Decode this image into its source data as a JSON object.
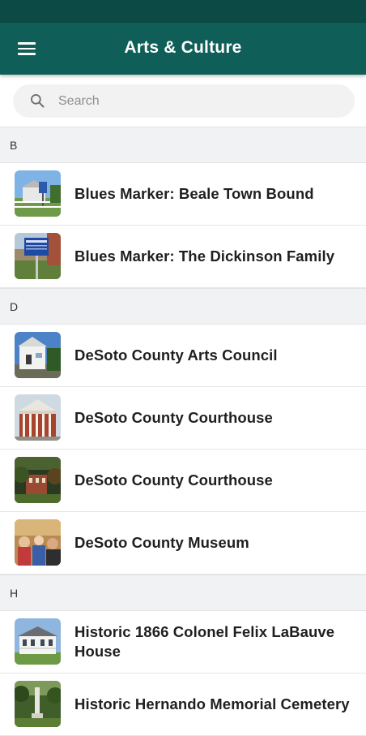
{
  "status_bar": {
    "glyph": "′′"
  },
  "app_bar": {
    "title": "Arts & Culture",
    "menu_icon": "hamburger-menu-icon"
  },
  "search": {
    "placeholder": "Search",
    "value": "",
    "icon": "search-icon"
  },
  "sections": [
    {
      "letter": "B",
      "items": [
        {
          "label": "Blues Marker: Beale Town Bound",
          "thumb": "marker-building"
        },
        {
          "label": "Blues Marker: The Dickinson Family",
          "thumb": "blue-sign"
        }
      ]
    },
    {
      "letter": "D",
      "items": [
        {
          "label": "DeSoto County Arts Council",
          "thumb": "white-building"
        },
        {
          "label": "DeSoto County Courthouse",
          "thumb": "courthouse-columns"
        },
        {
          "label": "DeSoto County Courthouse",
          "thumb": "courthouse-trees"
        },
        {
          "label": "DeSoto County Museum",
          "thumb": "museum-crowd"
        }
      ]
    },
    {
      "letter": "H",
      "items": [
        {
          "label": "Historic 1866 Colonel Felix LaBauve House",
          "thumb": "white-house"
        },
        {
          "label": "Historic Hernando Memorial Cemetery",
          "thumb": "cemetery-monument"
        }
      ]
    }
  ],
  "colors": {
    "status_bar": "#0c4a45",
    "app_bar": "#0f5e58",
    "section_header_bg": "#f1f2f4",
    "row_text": "#1f1f1f"
  }
}
